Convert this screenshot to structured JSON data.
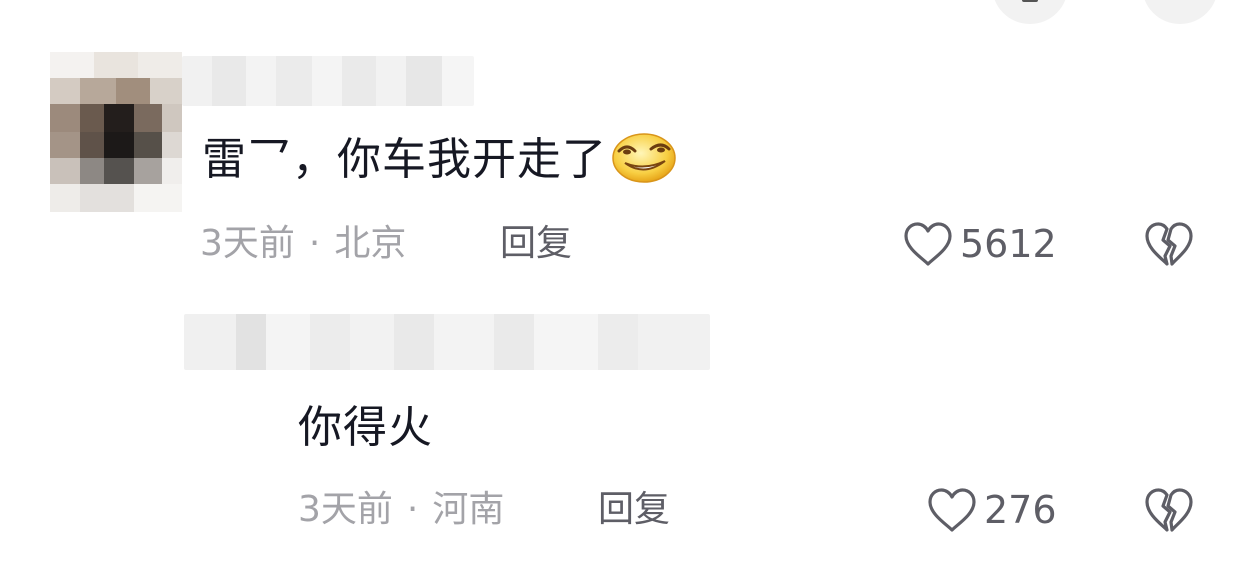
{
  "comments": [
    {
      "text": "雷乛，你车我开走了",
      "time": "3天前",
      "location": "北京",
      "reply_label": "回复",
      "likes": "5612"
    },
    {
      "text": "你得火",
      "time": "3天前",
      "location": "河南",
      "reply_label": "回复",
      "likes": "276"
    }
  ],
  "separator": "·",
  "icons": {
    "like": "heart-outline-icon",
    "dislike": "broken-heart-icon",
    "emoji": "sly-grin-emoji-icon"
  },
  "colors": {
    "text_primary": "#161823",
    "text_secondary": "#a3a3a8",
    "text_action": "#5e5e66"
  }
}
